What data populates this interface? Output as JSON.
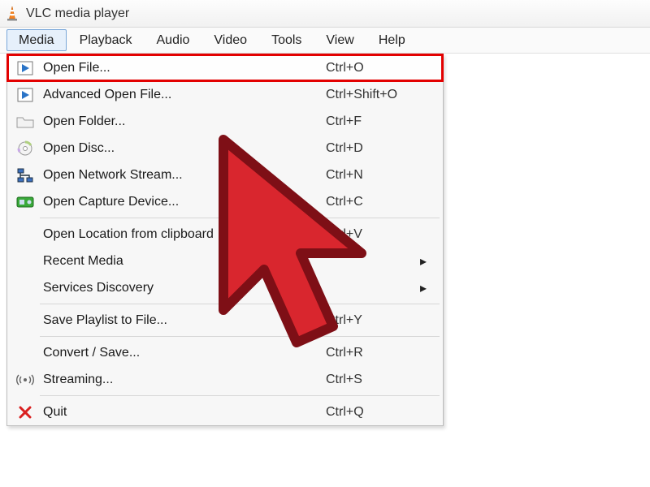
{
  "window": {
    "title": "VLC media player"
  },
  "menubar": {
    "items": [
      "Media",
      "Playback",
      "Audio",
      "Video",
      "Tools",
      "View",
      "Help"
    ],
    "active_index": 0
  },
  "dropdown": {
    "groups": [
      [
        {
          "icon": "play-file-icon",
          "label": "Open File...",
          "shortcut": "Ctrl+O",
          "highlight": true
        },
        {
          "icon": "play-file-icon",
          "label": "Advanced Open File...",
          "shortcut": "Ctrl+Shift+O"
        },
        {
          "icon": "folder-icon",
          "label": "Open Folder...",
          "shortcut": "Ctrl+F"
        },
        {
          "icon": "disc-icon",
          "label": "Open Disc...",
          "shortcut": "Ctrl+D"
        },
        {
          "icon": "network-icon",
          "label": "Open Network Stream...",
          "shortcut": "Ctrl+N"
        },
        {
          "icon": "capture-icon",
          "label": "Open Capture Device...",
          "shortcut": "Ctrl+C"
        }
      ],
      [
        {
          "icon": "",
          "label": "Open Location from clipboard",
          "shortcut": "Ctrl+V"
        },
        {
          "icon": "",
          "label": "Recent Media",
          "submenu": true
        },
        {
          "icon": "",
          "label": "Services Discovery",
          "submenu": true
        }
      ],
      [
        {
          "icon": "",
          "label": "Save Playlist to File...",
          "shortcut": "Ctrl+Y"
        }
      ],
      [
        {
          "icon": "",
          "label": "Convert / Save...",
          "shortcut": "Ctrl+R"
        },
        {
          "icon": "stream-icon",
          "label": "Streaming...",
          "shortcut": "Ctrl+S"
        }
      ],
      [
        {
          "icon": "quit-icon",
          "label": "Quit",
          "shortcut": "Ctrl+Q"
        }
      ]
    ]
  }
}
